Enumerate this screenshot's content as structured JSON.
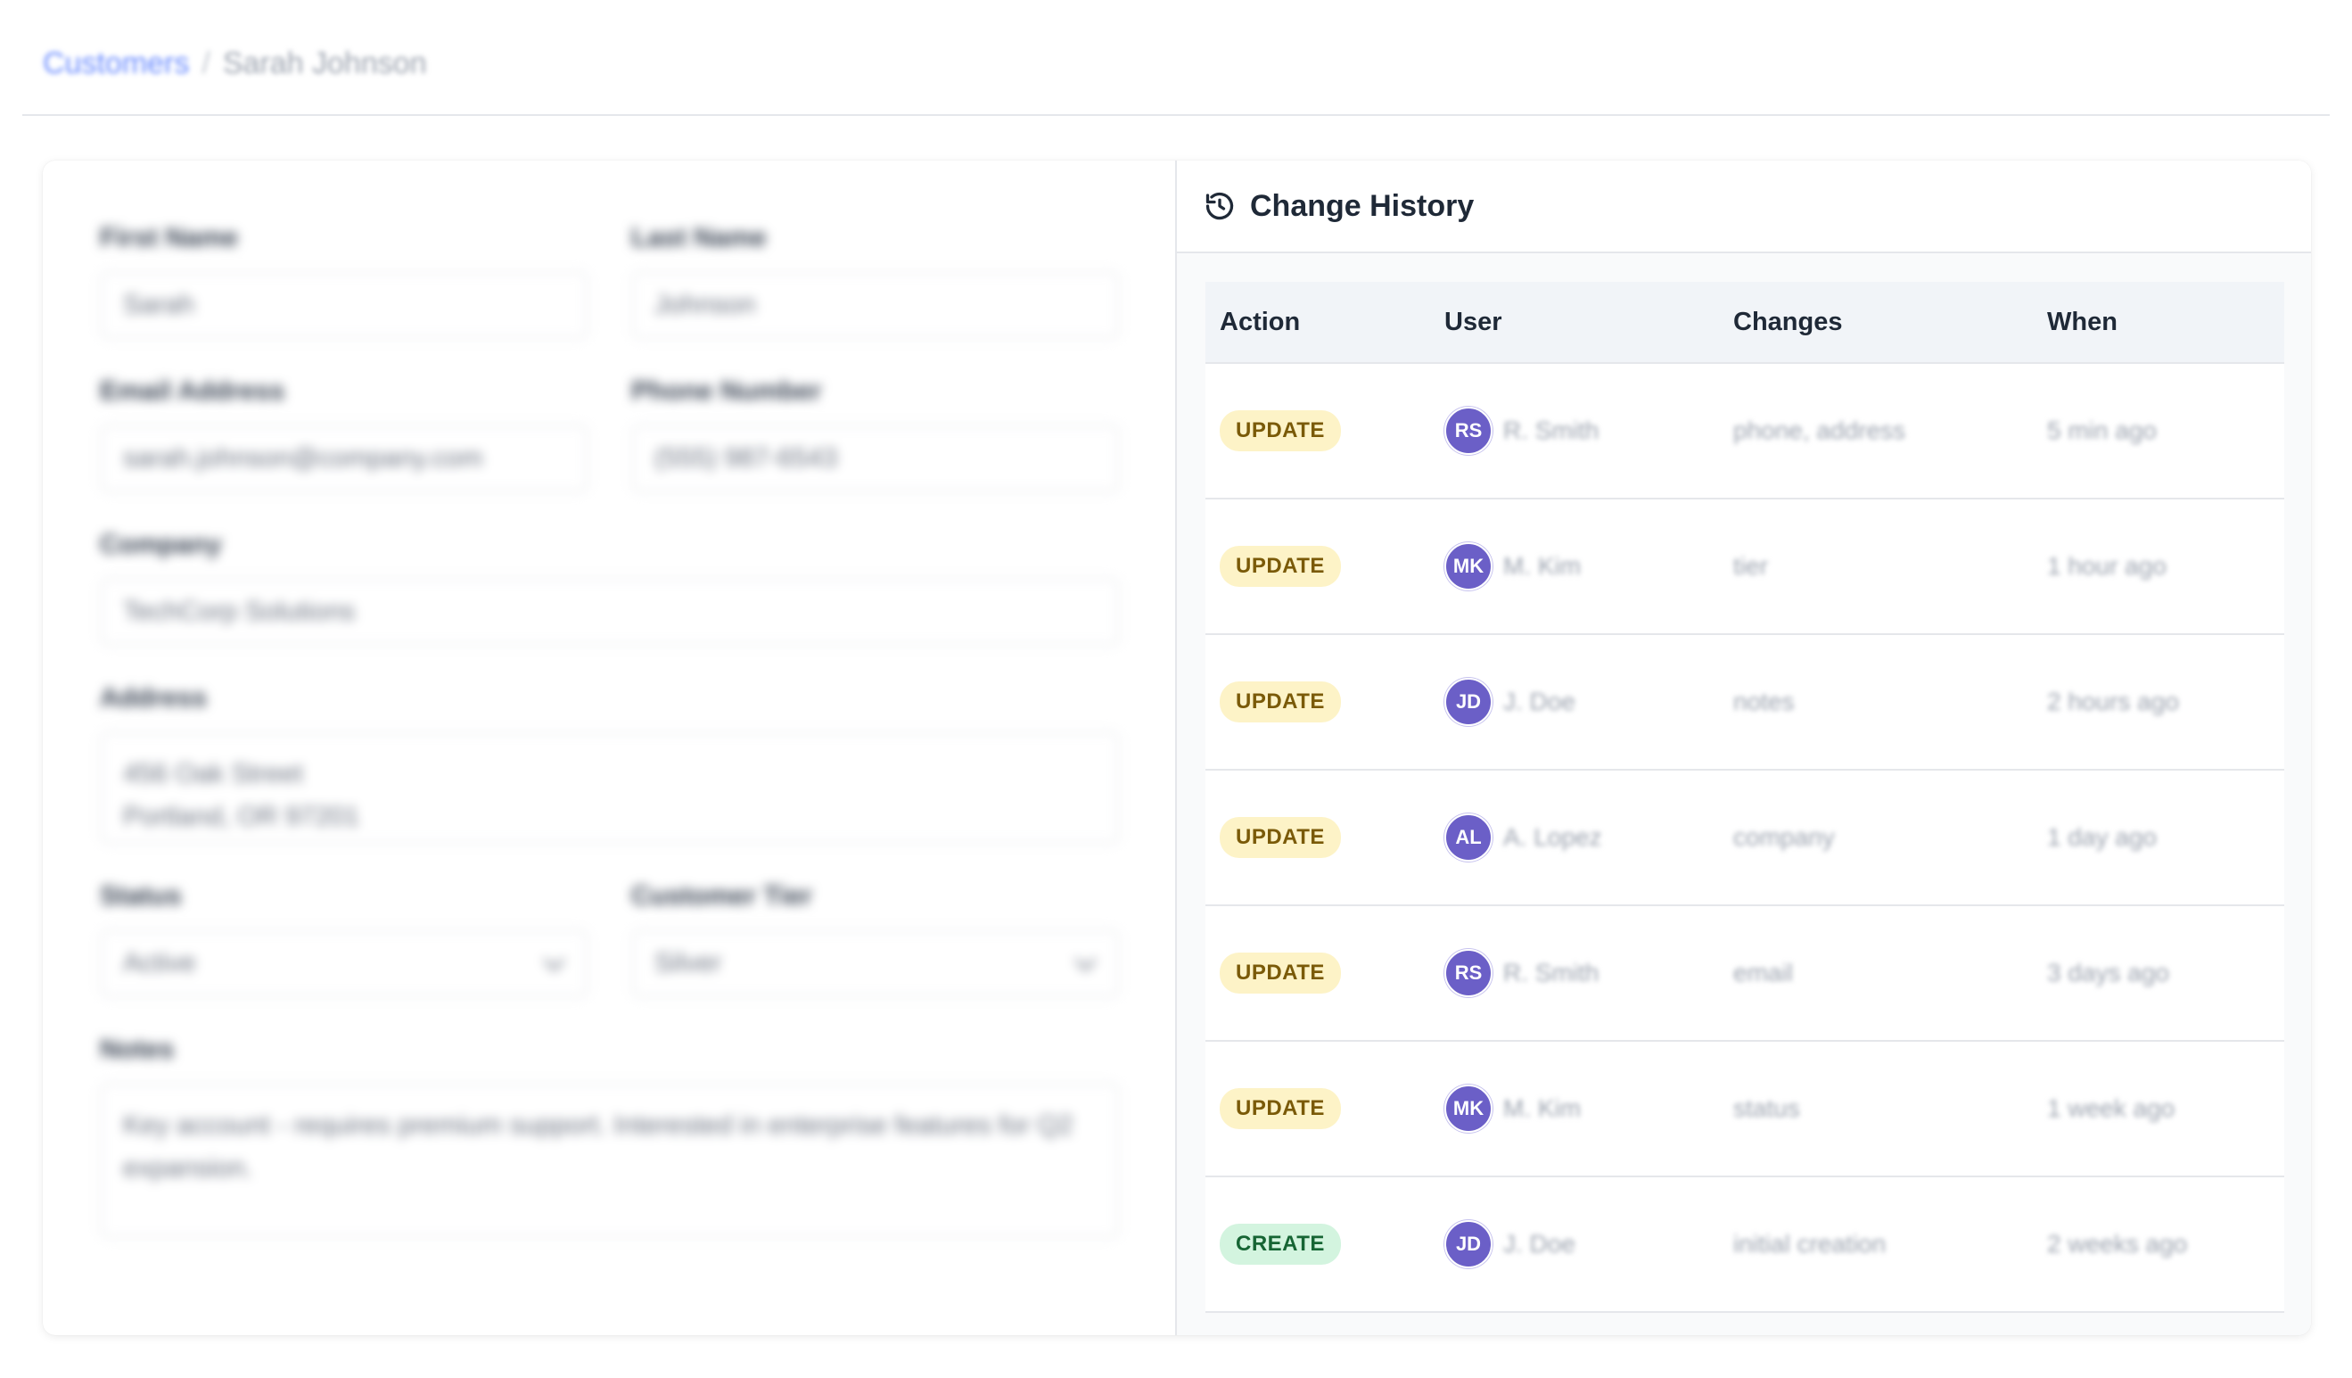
{
  "breadcrumb": {
    "parent": "Customers",
    "separator": "/",
    "current": "Sarah Johnson"
  },
  "form": {
    "first_name": {
      "label": "First Name",
      "value": "Sarah"
    },
    "last_name": {
      "label": "Last Name",
      "value": "Johnson"
    },
    "email": {
      "label": "Email Address",
      "value": "sarah.johnson@company.com"
    },
    "phone": {
      "label": "Phone Number",
      "value": "(555) 987-6543"
    },
    "company": {
      "label": "Company",
      "value": "TechCorp Solutions"
    },
    "address": {
      "label": "Address",
      "value": "456 Oak Street\nPortland, OR 97201"
    },
    "status": {
      "label": "Status",
      "value": "Active"
    },
    "tier": {
      "label": "Customer Tier",
      "value": "Silver"
    },
    "notes": {
      "label": "Notes",
      "value": "Key account - requires premium support. Interested in enterprise features for Q2 expansion."
    }
  },
  "history": {
    "title": "Change History",
    "icon": "history-icon",
    "columns": [
      "Action",
      "User",
      "Changes",
      "When"
    ],
    "rows": [
      {
        "action": "UPDATE",
        "type": "update",
        "initials": "RS",
        "user": "R. Smith",
        "changes": "phone, address",
        "when": "5 min ago"
      },
      {
        "action": "UPDATE",
        "type": "update",
        "initials": "MK",
        "user": "M. Kim",
        "changes": "tier",
        "when": "1 hour ago"
      },
      {
        "action": "UPDATE",
        "type": "update",
        "initials": "JD",
        "user": "J. Doe",
        "changes": "notes",
        "when": "2 hours ago"
      },
      {
        "action": "UPDATE",
        "type": "update",
        "initials": "AL",
        "user": "A. Lopez",
        "changes": "company",
        "when": "1 day ago"
      },
      {
        "action": "UPDATE",
        "type": "update",
        "initials": "RS",
        "user": "R. Smith",
        "changes": "email",
        "when": "3 days ago"
      },
      {
        "action": "UPDATE",
        "type": "update",
        "initials": "MK",
        "user": "M. Kim",
        "changes": "status",
        "when": "1 week ago"
      },
      {
        "action": "CREATE",
        "type": "create",
        "initials": "JD",
        "user": "J. Doe",
        "changes": "initial creation",
        "when": "2 weeks ago"
      }
    ]
  },
  "colors": {
    "update_badge": "#fdf3c7",
    "create_badge": "#d3f4df",
    "avatar": "#6b5fc7"
  }
}
